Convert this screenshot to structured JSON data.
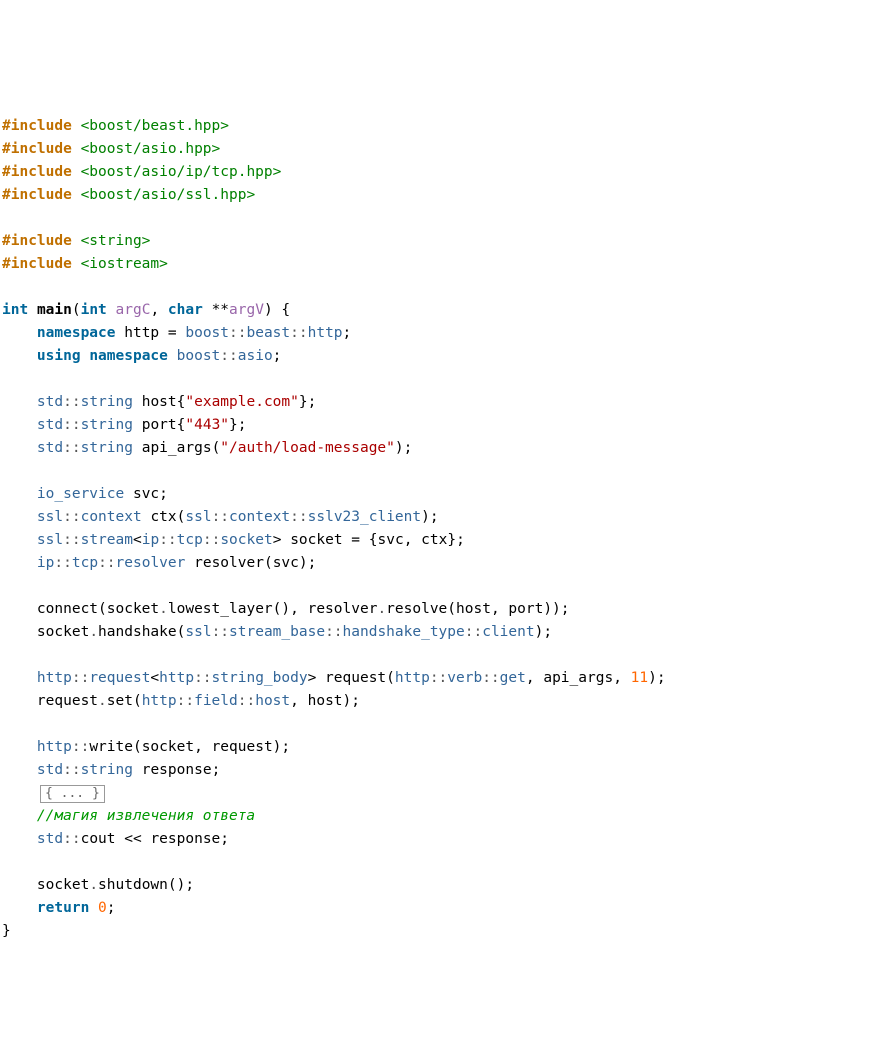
{
  "code": {
    "inc1_kw": "#include ",
    "inc1_hdr": "<boost/beast.hpp>",
    "inc2_kw": "#include ",
    "inc2_hdr": "<boost/asio.hpp>",
    "inc3_kw": "#include ",
    "inc3_hdr": "<boost/asio/ip/tcp.hpp>",
    "inc4_kw": "#include ",
    "inc4_hdr": "<boost/asio/ssl.hpp>",
    "inc5_kw": "#include ",
    "inc5_hdr": "<string>",
    "inc6_kw": "#include ",
    "inc6_hdr": "<iostream>",
    "kw_int": "int",
    "fn_main": "main",
    "lp": "(",
    "kw_int2": "int",
    "sp": " ",
    "var_argc": "argC",
    "comma": ", ",
    "kw_char": "char",
    "dstar": " **",
    "var_argv": "argV",
    "rp_brace": ") {",
    "kw_namespace": "namespace",
    "id_http": "http",
    "eq": " = ",
    "ns_boost": "boost",
    "dcol": "::",
    "ns_beast": "beast",
    "ns_httpend": "http",
    "semi": ";",
    "kw_using": "using",
    "kw_namespace2": "namespace",
    "ns_asio": "asio",
    "ns_std": "std",
    "ty_string": "string",
    "var_host": "host",
    "brace_open": "{",
    "str_host": "\"example.com\"",
    "brace_close_semi": "};",
    "var_port": "port",
    "str_port": "\"443\"",
    "var_api": "api_args",
    "paren_open": "(",
    "str_api": "\"/auth/load-message\"",
    "paren_close_semi": ");",
    "ty_io_service": "io_service",
    "var_svc": "svc",
    "ns_ssl": "ssl",
    "ty_context": "context",
    "var_ctx": "ctx",
    "id_sslv23": "sslv23_client",
    "ty_stream": "stream",
    "lt": "<",
    "ns_ip": "ip",
    "ns_tcp": "tcp",
    "ty_socket": "socket",
    "gt": ">",
    "var_socket": "socket",
    "eq_brace": " = {",
    "id_svc2": "svc",
    "id_ctx2": "ctx",
    "ty_resolver": "resolver",
    "var_resolver": "resolver",
    "fn_connect": "connect",
    "id_socket2": "socket",
    "dot": ".",
    "fn_lowest": "lowest_layer",
    "empty_parens": "()",
    "id_resolver2": "resolver",
    "fn_resolve": "resolve",
    "id_host2": "host",
    "id_port2": "port",
    "dparen_semi": "));",
    "fn_handshake": "handshake",
    "ty_stream_base": "stream_base",
    "ty_handshake_type": "handshake_type",
    "id_client": "client",
    "ty_request": "request",
    "ty_string_body": "string_body",
    "var_request": "request",
    "ty_verb": "verb",
    "id_get": "get",
    "id_api2": "api_args",
    "num_11": "11",
    "id_request2": "request",
    "fn_set": "set",
    "ty_field": "field",
    "id_hostfield": "host",
    "fn_write": "write",
    "var_response": "response",
    "fold_text": "{ ... }",
    "comment_magic": "//магия извлечения ответа",
    "id_cout": "cout",
    "op_ins": " << ",
    "id_response2": "response",
    "fn_shutdown": "shutdown",
    "kw_return": "return",
    "num_0": "0",
    "close_brace": "}"
  }
}
